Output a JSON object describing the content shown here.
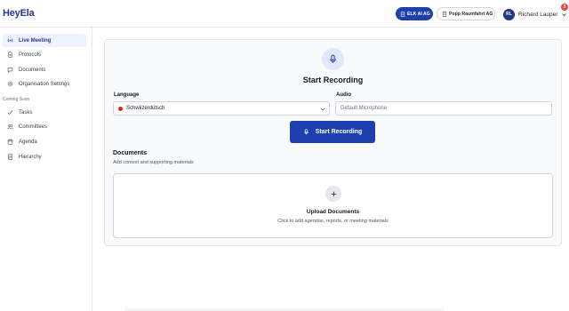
{
  "app": {
    "logo": "HeyEla"
  },
  "header": {
    "org_primary": "ELK AI AG",
    "org_secondary": "Popp Raumfahrt AG",
    "user_initials": "RL",
    "user_name": "Richard Lauper",
    "notification_count": "3",
    "colors": {
      "primary": "#1e40af",
      "notification": "#ef4444"
    }
  },
  "sidebar": {
    "items": [
      {
        "label": "Live Meeting",
        "icon": "radio-icon",
        "active": true
      },
      {
        "label": "Protocols",
        "icon": "document-icon"
      },
      {
        "label": "Documents",
        "icon": "chat-icon"
      },
      {
        "label": "Organisation Settings",
        "icon": "gear-icon"
      }
    ],
    "coming_soon_label": "Coming Soon",
    "coming_soon_items": [
      {
        "label": "Tasks",
        "icon": "check-icon"
      },
      {
        "label": "Committees",
        "icon": "users-icon"
      },
      {
        "label": "Agenda",
        "icon": "calendar-icon"
      },
      {
        "label": "Hierarchy",
        "icon": "hierarchy-icon"
      }
    ]
  },
  "main": {
    "title": "Start Recording",
    "language_label": "Language",
    "language_value": "Schwiizerdütsch",
    "audio_label": "Audio",
    "audio_placeholder": "Default Microphone",
    "record_button": "Start Recording",
    "documents_title": "Documents",
    "documents_subtitle": "Add context and supporting materials",
    "upload_title": "Upload Documents",
    "upload_subtitle": "Click to add agendas, reports, or meeting materials"
  }
}
